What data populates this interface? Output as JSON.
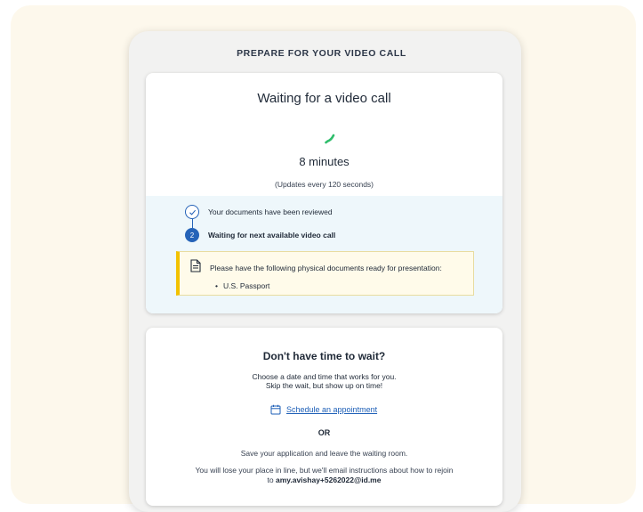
{
  "header": {
    "title": "PREPARE FOR YOUR VIDEO CALL"
  },
  "waiting_card": {
    "title": "Waiting for a video call",
    "wait_time": "8 minutes",
    "update_note": "(Updates every 120 seconds)",
    "steps": [
      {
        "number": "",
        "label": "Your documents have been reviewed",
        "status": "complete"
      },
      {
        "number": "2",
        "label": "Waiting for next available video call",
        "status": "current"
      }
    ],
    "notice": {
      "text": "Please have the following physical documents ready for presentation:",
      "items": [
        "U.S. Passport"
      ]
    }
  },
  "reschedule_card": {
    "title": "Don't have time to wait?",
    "subtitle_line1": "Choose a date and time that works for you.",
    "subtitle_line2": "Skip the wait, but show up on time!",
    "schedule_link": "Schedule an appointment",
    "or_label": "OR",
    "save_text": "Save your application and leave the waiting room.",
    "lose_text": "You will lose your place in line, but we'll email instructions about how to rejoin",
    "email_prefix": "to",
    "email": "amy.avishay+5262022@id.me"
  },
  "colors": {
    "background": "#fdf8ec",
    "accent_blue": "#2563b8",
    "success_green": "#2ebd6b",
    "notice_bar": "#f2c200",
    "status_panel": "#eef7fb"
  },
  "icons": [
    "phone-icon",
    "check-icon",
    "document-icon",
    "calendar-icon"
  ]
}
